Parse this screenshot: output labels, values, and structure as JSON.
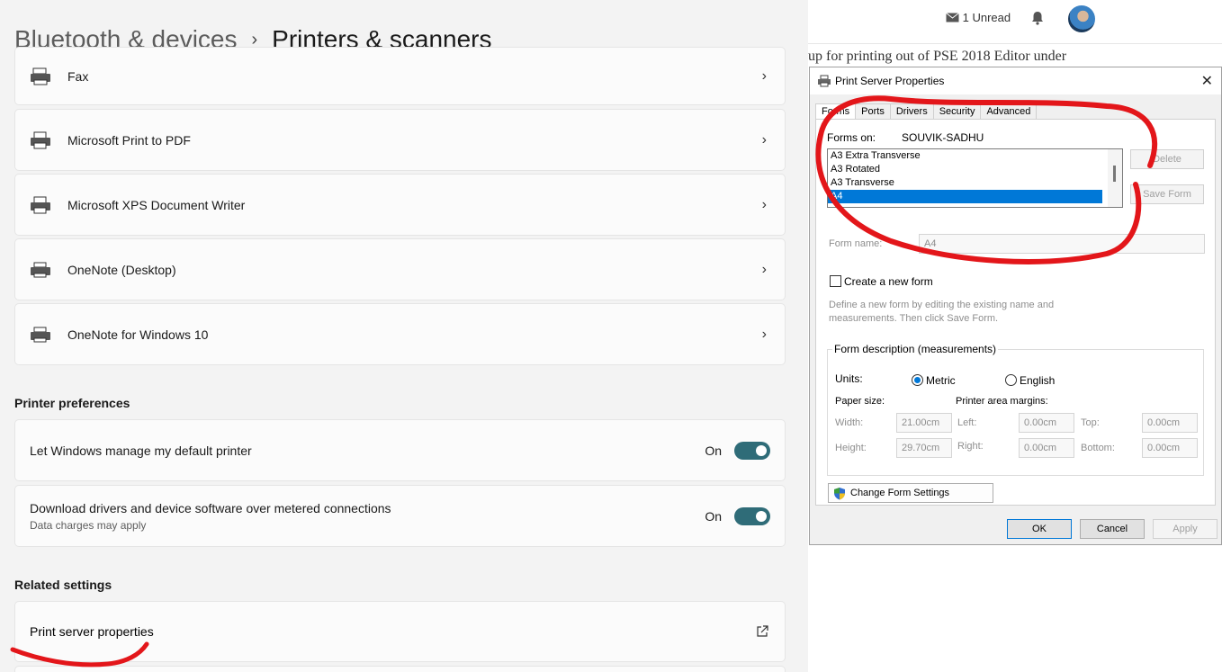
{
  "settings": {
    "breadcrumb": {
      "parent": "Bluetooth & devices",
      "separator": "›",
      "current": "Printers & scanners"
    },
    "printers": [
      {
        "label": "Fax",
        "icon": "fax-icon"
      },
      {
        "label": "Microsoft Print to PDF",
        "icon": "printer-icon"
      },
      {
        "label": "Microsoft XPS Document Writer",
        "icon": "printer-icon"
      },
      {
        "label": "OneNote (Desktop)",
        "icon": "printer-icon"
      },
      {
        "label": "OneNote for Windows 10",
        "icon": "printer-icon"
      }
    ],
    "chevron": "›",
    "preferences_heading": "Printer preferences",
    "preferences": [
      {
        "label": "Let Windows manage my default printer",
        "sub": "",
        "state": "On",
        "on": true
      },
      {
        "label": "Download drivers and device software over metered connections",
        "sub": "Data charges may apply",
        "state": "On",
        "on": true
      }
    ],
    "related_heading": "Related settings",
    "related": [
      {
        "label": "Print server properties",
        "icon": "external-link-icon"
      }
    ],
    "accent_color": "#2f6c78"
  },
  "background_page": {
    "unread": "1 Unread",
    "article_text": "up for printing out of PSE 2018 Editor under"
  },
  "dialog": {
    "title": "Print Server Properties",
    "close": "✕",
    "tabs": [
      "Forms",
      "Ports",
      "Drivers",
      "Security",
      "Advanced"
    ],
    "active_tab": "Forms",
    "forms_on_label": "Forms on:",
    "server_name": "SOUVIK-SADHU",
    "forms": [
      "A3 Extra Transverse",
      "A3 Rotated",
      "A3 Transverse",
      "A4"
    ],
    "selected_form": "A4",
    "delete_label": "Delete",
    "save_form_label": "Save Form",
    "form_name_label": "Form name:",
    "form_name_value": "A4",
    "create_new_label": "Create a new form",
    "create_new_checked": false,
    "help_text_line1": "Define a new form by editing the existing name and",
    "help_text_line2": "measurements. Then click Save Form.",
    "description_group": "Form description (measurements)",
    "units_label": "Units:",
    "unit_metric": "Metric",
    "unit_english": "English",
    "selected_unit": "Metric",
    "paper_size_label": "Paper size:",
    "margins_label": "Printer area margins:",
    "width_label": "Width:",
    "width_value": "21.00cm",
    "height_label": "Height:",
    "height_value": "29.70cm",
    "left_label": "Left:",
    "left_value": "0.00cm",
    "right_label": "Right:",
    "right_value": "0.00cm",
    "top_label": "Top:",
    "top_value": "0.00cm",
    "bottom_label": "Bottom:",
    "bottom_value": "0.00cm",
    "change_settings_label": "Change Form Settings",
    "ok_label": "OK",
    "cancel_label": "Cancel",
    "apply_label": "Apply",
    "selection_color": "#0078d7"
  },
  "annotations": {
    "marker_color": "#e3161a"
  }
}
